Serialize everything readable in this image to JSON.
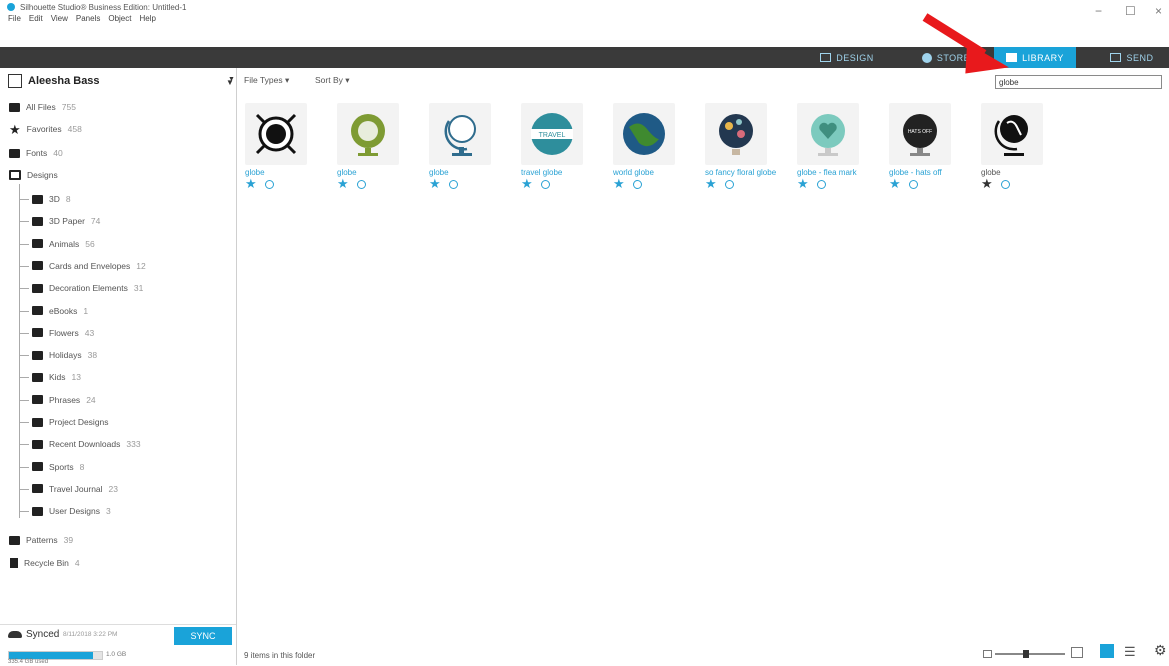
{
  "window": {
    "title": "Silhouette Studio® Business Edition: Untitled-1",
    "menu": [
      "File",
      "Edit",
      "View",
      "Panels",
      "Object",
      "Help"
    ],
    "controls": {
      "minimize": "−",
      "maximize": "☐",
      "close": "×"
    }
  },
  "tabs": [
    {
      "label": "DESIGN",
      "icon": "design-grid-icon",
      "active": false
    },
    {
      "label": "STORE",
      "icon": "store-globe-icon",
      "active": false
    },
    {
      "label": "LIBRARY",
      "icon": "library-icon",
      "active": true
    },
    {
      "label": "SEND",
      "icon": "send-cutter-icon",
      "active": false
    }
  ],
  "accent_color": "#1aa3d9",
  "sidebar": {
    "user": "Aleesha Bass",
    "top_items": [
      {
        "label": "All Files",
        "count": "755",
        "icon": "folder-icon"
      },
      {
        "label": "Favorites",
        "count": "458",
        "icon": "star-icon"
      },
      {
        "label": "Fonts",
        "count": "40",
        "icon": "folder-icon"
      },
      {
        "label": "Designs",
        "count": "",
        "icon": "folder-open-icon"
      }
    ],
    "design_folders": [
      {
        "label": "3D",
        "count": "8"
      },
      {
        "label": "3D Paper",
        "count": "74"
      },
      {
        "label": "Animals",
        "count": "56"
      },
      {
        "label": "Cards and Envelopes",
        "count": "12"
      },
      {
        "label": "Decoration Elements",
        "count": "31"
      },
      {
        "label": "eBooks",
        "count": "1"
      },
      {
        "label": "Flowers",
        "count": "43"
      },
      {
        "label": "Holidays",
        "count": "38"
      },
      {
        "label": "Kids",
        "count": "13"
      },
      {
        "label": "Phrases",
        "count": "24"
      },
      {
        "label": "Project Designs",
        "count": ""
      },
      {
        "label": "Recent Downloads",
        "count": "333"
      },
      {
        "label": "Sports",
        "count": "8"
      },
      {
        "label": "Travel Journal",
        "count": "23"
      },
      {
        "label": "User Designs",
        "count": "3"
      }
    ],
    "bottom_items": [
      {
        "label": "Patterns",
        "count": "39",
        "icon": "folder-icon"
      },
      {
        "label": "Recycle Bin",
        "count": "4",
        "icon": "trash-icon"
      }
    ],
    "sync": {
      "status": "Synced",
      "timestamp": "8/11/2018 3:22 PM",
      "button": "SYNC",
      "storage_used": "335.4 GB used",
      "storage_total": "1.0 GB",
      "progress": 0.9
    }
  },
  "toolbar": {
    "file_types": "File Types",
    "sort_by": "Sort By",
    "search_value": "globe"
  },
  "items": [
    {
      "label": "globe",
      "favorite": true
    },
    {
      "label": "globe",
      "favorite": true
    },
    {
      "label": "globe",
      "favorite": true
    },
    {
      "label": "travel globe",
      "favorite": true
    },
    {
      "label": "world globe",
      "favorite": true
    },
    {
      "label": "so fancy floral globe",
      "favorite": true
    },
    {
      "label": "globe - flea mark",
      "favorite": true
    },
    {
      "label": "globe - hats off",
      "favorite": true
    },
    {
      "label": "globe",
      "favorite": false
    }
  ],
  "status_bar": {
    "items_text": "9 items in this folder"
  }
}
